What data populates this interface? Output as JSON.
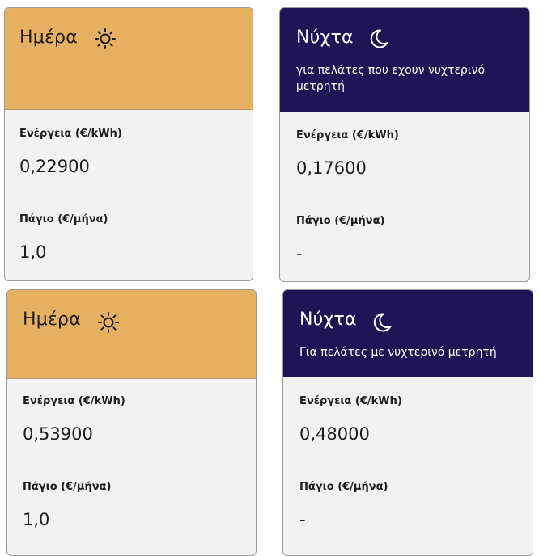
{
  "cards": [
    {
      "title": "Ημέρα",
      "icon": "sun-icon",
      "energy_label": "Ενέργεια (€/kWh)",
      "energy_value": "0,22900",
      "fee_label": "Πάγιο (€/μήνα)",
      "fee_value": "1,0"
    },
    {
      "title": "Νύχτα",
      "icon": "moon-icon",
      "subtitle": "για πελάτες που εχουν νυχτερινό μετρητή",
      "energy_label": "Ενέργεια (€/kWh)",
      "energy_value": "0,17600",
      "fee_label": "Πάγιο (€/μήνα)",
      "fee_value": "-"
    },
    {
      "title": "Ημέρα",
      "icon": "sun-icon",
      "energy_label": "Ενέργεια (€/kWh)",
      "energy_value": "0,53900",
      "fee_label": "Πάγιο (€/μήνα)",
      "fee_value": "1,0"
    },
    {
      "title": "Νύχτα",
      "icon": "moon-icon",
      "subtitle": "Για πελάτες με νυχτερινό μετρητή",
      "energy_label": "Ενέργεια (€/kWh)",
      "energy_value": "0,48000",
      "fee_label": "Πάγιο (€/μήνα)",
      "fee_value": "-"
    }
  ],
  "colors": {
    "day_header": "#e6b062",
    "night_header": "#1f1456",
    "card_body": "#f2f2f2"
  }
}
